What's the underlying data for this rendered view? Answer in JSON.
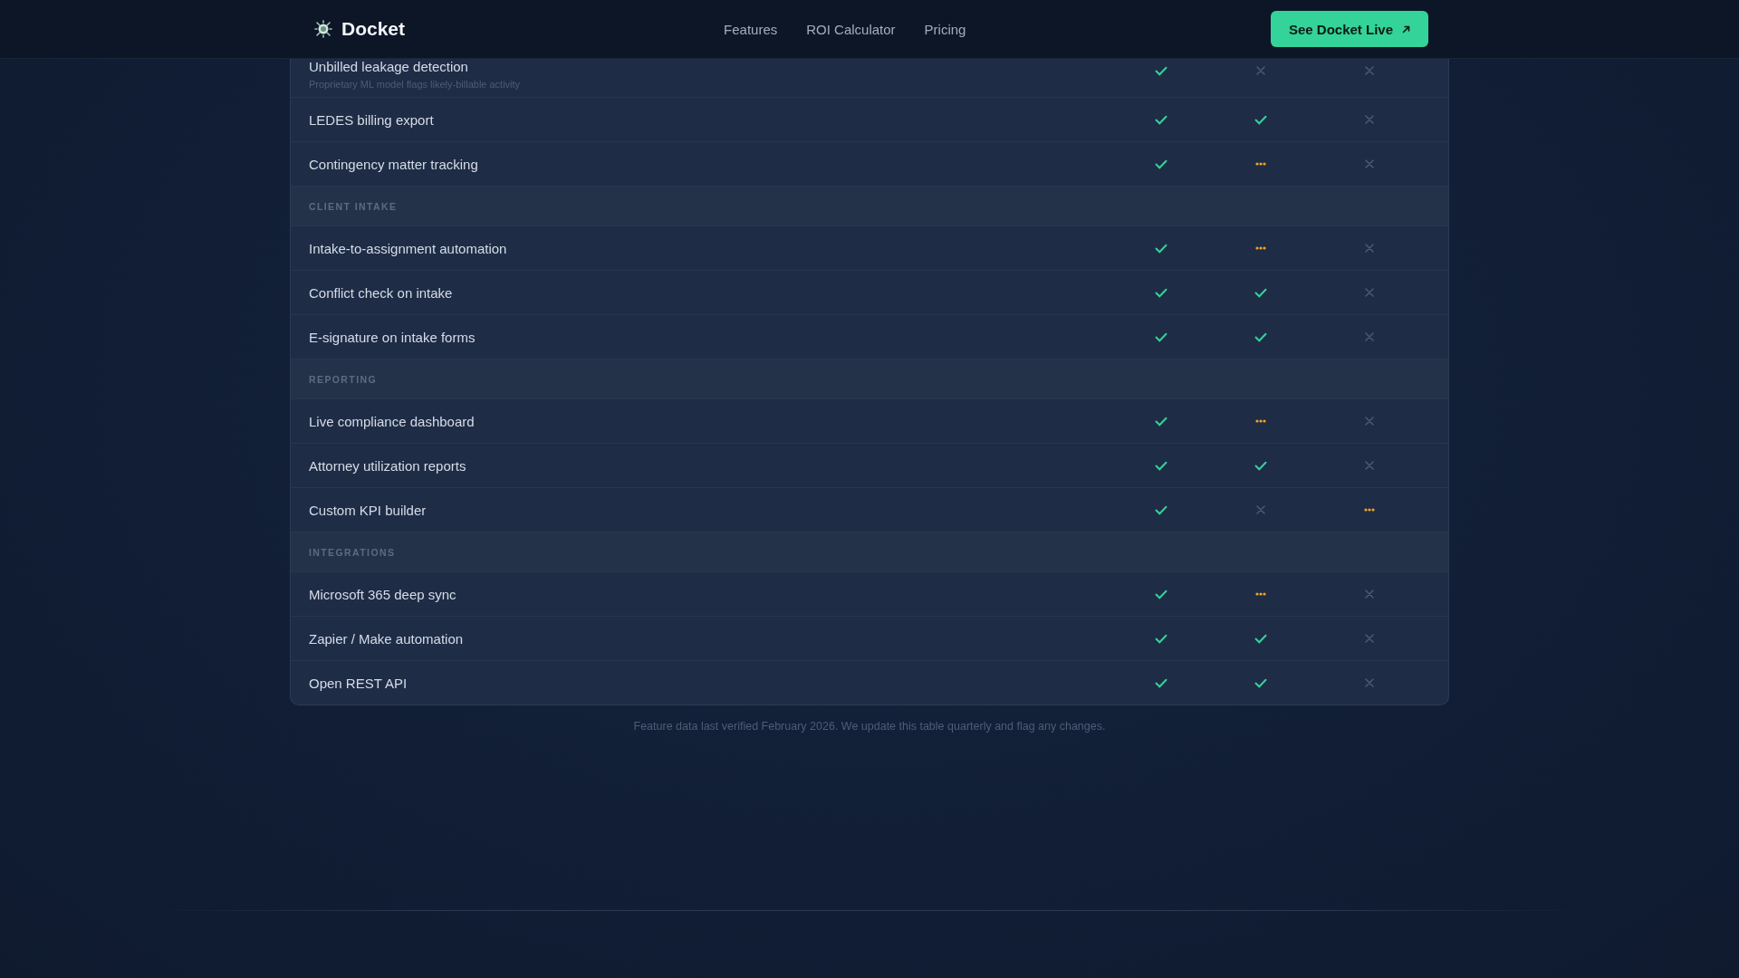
{
  "nav": {
    "brand": "Docket",
    "links": [
      "Features",
      "ROI Calculator",
      "Pricing"
    ],
    "cta": "See Docket Live"
  },
  "rows": [
    {
      "kind": "feature",
      "label": "Unbilled leakage detection",
      "note": "Proprietary ML model flags likely-billable activity",
      "cells": [
        {
          "kind": "yes"
        },
        {
          "kind": "no"
        },
        {
          "kind": "no"
        }
      ]
    },
    {
      "kind": "feature",
      "label": "LEDES billing export",
      "cells": [
        {
          "kind": "yes"
        },
        {
          "kind": "yes"
        },
        {
          "kind": "no"
        }
      ]
    },
    {
      "kind": "feature",
      "label": "Contingency matter tracking",
      "cells": [
        {
          "kind": "yes"
        },
        {
          "kind": "partial"
        },
        {
          "kind": "no"
        }
      ]
    },
    {
      "kind": "section",
      "label": "CLIENT INTAKE"
    },
    {
      "kind": "feature",
      "label": "Intake-to-assignment automation",
      "cells": [
        {
          "kind": "yes"
        },
        {
          "kind": "partial"
        },
        {
          "kind": "no"
        }
      ]
    },
    {
      "kind": "feature",
      "label": "Conflict check on intake",
      "cells": [
        {
          "kind": "yes"
        },
        {
          "kind": "yes"
        },
        {
          "kind": "no"
        }
      ]
    },
    {
      "kind": "feature",
      "label": "E-signature on intake forms",
      "cells": [
        {
          "kind": "yes"
        },
        {
          "kind": "yes"
        },
        {
          "kind": "no"
        }
      ]
    },
    {
      "kind": "section",
      "label": "REPORTING"
    },
    {
      "kind": "feature",
      "label": "Live compliance dashboard",
      "cells": [
        {
          "kind": "yes"
        },
        {
          "kind": "partial"
        },
        {
          "kind": "no"
        }
      ]
    },
    {
      "kind": "feature",
      "label": "Attorney utilization reports",
      "cells": [
        {
          "kind": "yes"
        },
        {
          "kind": "yes"
        },
        {
          "kind": "no"
        }
      ]
    },
    {
      "kind": "feature",
      "label": "Custom KPI builder",
      "cells": [
        {
          "kind": "yes"
        },
        {
          "kind": "no"
        },
        {
          "kind": "partial"
        }
      ]
    },
    {
      "kind": "section",
      "label": "INTEGRATIONS"
    },
    {
      "kind": "feature",
      "label": "Microsoft 365 deep sync",
      "cells": [
        {
          "kind": "yes"
        },
        {
          "kind": "partial"
        },
        {
          "kind": "no"
        }
      ]
    },
    {
      "kind": "feature",
      "label": "Zapier / Make automation",
      "cells": [
        {
          "kind": "yes"
        },
        {
          "kind": "yes"
        },
        {
          "kind": "no"
        }
      ]
    },
    {
      "kind": "feature",
      "label": "Open REST API",
      "cells": [
        {
          "kind": "yes"
        },
        {
          "kind": "yes"
        },
        {
          "kind": "no"
        }
      ]
    }
  ],
  "footnote": "Feature data last verified February 2026. We update this table quarterly and flag any changes."
}
